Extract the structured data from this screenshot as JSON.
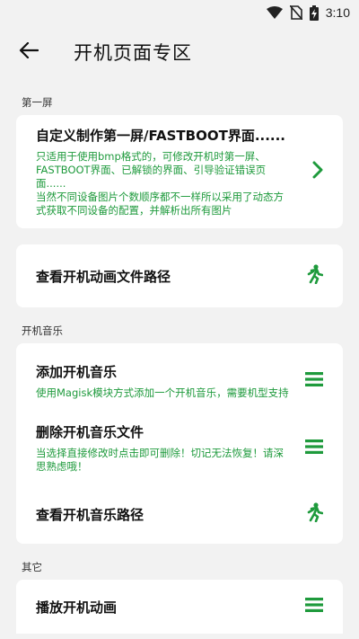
{
  "status_bar": {
    "time": "3:10",
    "icons": [
      "wifi-icon",
      "no-sim-icon",
      "battery-charging-icon"
    ]
  },
  "app_bar": {
    "back_icon": "arrow-back-icon",
    "title": "开机页面专区"
  },
  "sections": {
    "first_screen": {
      "label": "第一屏",
      "item": {
        "title": "自定义制作第一屏/FASTBOOT界面......",
        "desc": "只适用于使用bmp格式的，可修改开机时第一屏、FASTBOOT界面、已解锁的界面、引导验证错误页面......\n当然不同设备图片个数顺序都不一样所以采用了动态方式获取不同设备的配置，并解析出所有图片",
        "icon": "chevron-right-icon"
      }
    },
    "animation_path": {
      "title": "查看开机动画文件路径",
      "icon": "running-person-icon"
    },
    "boot_music": {
      "label": "开机音乐",
      "items": [
        {
          "title": "添加开机音乐",
          "desc": "使用Magisk模块方式添加一个开机音乐，需要机型支持",
          "icon": "menu-lines-icon"
        },
        {
          "title": "删除开机音乐文件",
          "desc": "当选择直接修改时点击即可删除！切记无法恢复！请深思熟虑哦！",
          "icon": "menu-lines-icon"
        },
        {
          "title": "查看开机音乐路径",
          "desc": "",
          "icon": "running-person-icon"
        }
      ]
    },
    "other": {
      "label": "其它",
      "items": [
        {
          "title": "播放开机动画",
          "icon": "menu-lines-icon"
        }
      ]
    }
  },
  "colors": {
    "accent_green": "#1e9a3c",
    "background": "#f2f2f2",
    "card": "#ffffff"
  }
}
